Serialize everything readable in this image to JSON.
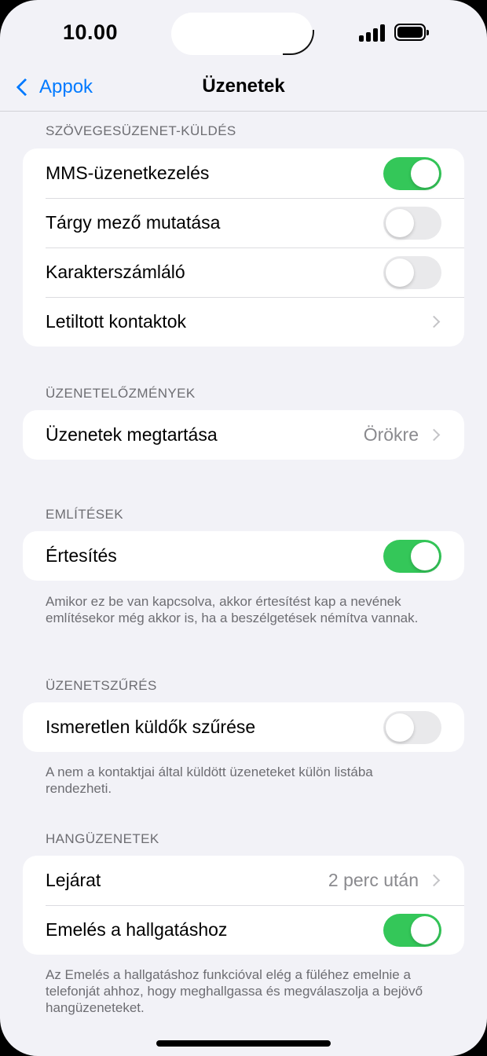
{
  "status_bar": {
    "time": "10.00"
  },
  "nav": {
    "back_label": "Appok",
    "title": "Üzenetek"
  },
  "sections": {
    "sms": {
      "header": "SZÖVEGESÜZENET-KÜLDÉS",
      "mms": {
        "label": "MMS-üzenetkezelés",
        "enabled": true
      },
      "subject": {
        "label": "Tárgy mező mutatása",
        "enabled": false
      },
      "char_count": {
        "label": "Karakterszámláló",
        "enabled": false
      },
      "blocked": {
        "label": "Letiltott kontaktok"
      }
    },
    "history": {
      "header": "ÜZENETELŐZMÉNYEK",
      "keep": {
        "label": "Üzenetek megtartása",
        "value": "Örökre"
      }
    },
    "mentions": {
      "header": "EMLÍTÉSEK",
      "notify": {
        "label": "Értesítés",
        "enabled": true
      },
      "footer": "Amikor ez be van kapcsolva, akkor értesítést kap a nevének említésekor még akkor is, ha a beszélgetések némítva vannak."
    },
    "filtering": {
      "header": "ÜZENETSZŰRÉS",
      "unknown": {
        "label": "Ismeretlen küldők szűrése",
        "enabled": false
      },
      "footer": "A nem a kontaktjai által küldött üzeneteket külön listába rendezheti."
    },
    "audio": {
      "header": "HANGÜZENETEK",
      "expire": {
        "label": "Lejárat",
        "value": "2 perc után"
      },
      "raise": {
        "label": "Emelés a hallgatáshoz",
        "enabled": true
      },
      "footer": "Az Emelés a hallgatáshoz funkcióval elég a füléhez emelnie a telefonját ahhoz, hogy meghallgassa és megválaszolja a bejövő hangüzeneteket."
    }
  },
  "colors": {
    "accent": "#007aff",
    "toggle_on": "#34c759",
    "toggle_off": "#e9e9eb",
    "background": "#f2f2f7"
  }
}
